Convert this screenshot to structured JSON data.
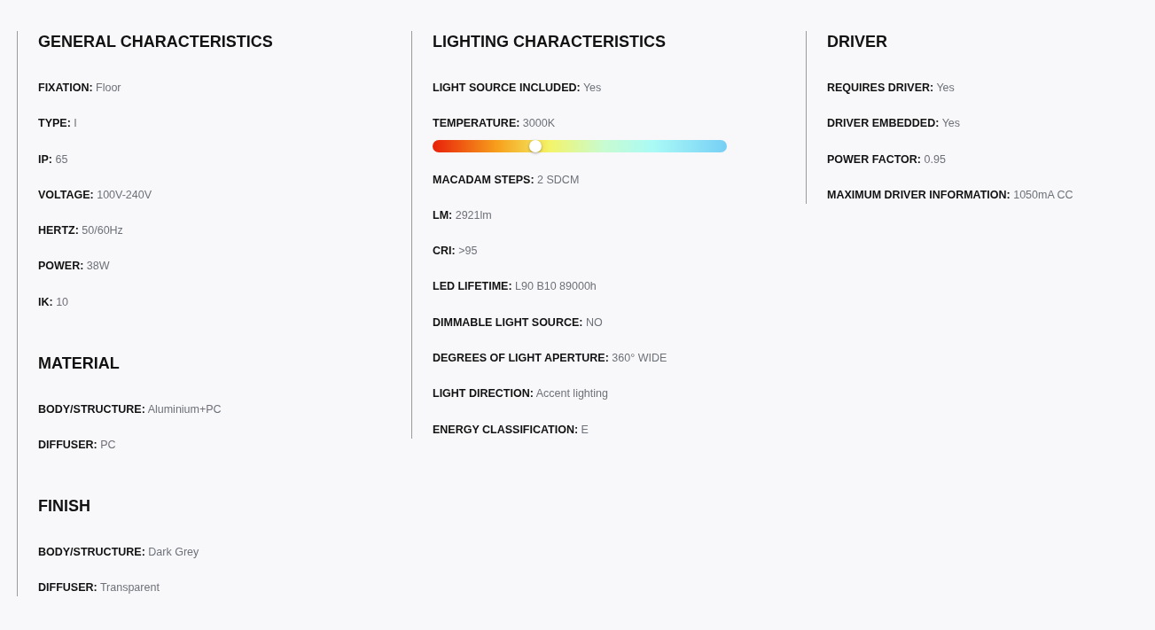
{
  "columns": [
    {
      "sections": [
        {
          "title": "GENERAL CHARACTERISTICS",
          "items": [
            {
              "label": "FIXATION:",
              "value": "Floor"
            },
            {
              "label": "TYPE:",
              "value": "I"
            },
            {
              "label": "IP:",
              "value": "65"
            },
            {
              "label": "VOLTAGE:",
              "value": "100V-240V"
            },
            {
              "label": "HERTZ:",
              "value": "50/60Hz"
            },
            {
              "label": "POWER:",
              "value": "38W"
            },
            {
              "label": "IK:",
              "value": "10"
            }
          ]
        },
        {
          "title": "MATERIAL",
          "items": [
            {
              "label": "BODY/STRUCTURE:",
              "value": "Aluminium+PC"
            },
            {
              "label": "DIFFUSER:",
              "value": "PC"
            }
          ]
        },
        {
          "title": "FINISH",
          "items": [
            {
              "label": "BODY/STRUCTURE:",
              "value": "Dark Grey"
            },
            {
              "label": "DIFFUSER:",
              "value": "Transparent"
            }
          ]
        }
      ]
    },
    {
      "sections": [
        {
          "title": "LIGHTING CHARACTERISTICS",
          "items": [
            {
              "label": "LIGHT SOURCE INCLUDED:",
              "value": "Yes"
            },
            {
              "label": "TEMPERATURE:",
              "value": "3000K",
              "scale": {
                "level": 0.35
              }
            },
            {
              "label": "MACADAM STEPS:",
              "value": "2 SDCM"
            },
            {
              "label": "LM:",
              "value": "2921lm"
            },
            {
              "label": "CRI:",
              "value": ">95"
            },
            {
              "label": "LED LIFETIME:",
              "value": "L90 B10 89000h"
            },
            {
              "label": "DIMMABLE LIGHT SOURCE:",
              "value": "NO"
            },
            {
              "label": "DEGREES OF LIGHT APERTURE:",
              "value": "360° WIDE"
            },
            {
              "label": "LIGHT DIRECTION:",
              "value": "Accent lighting"
            },
            {
              "label": "ENERGY CLASSIFICATION:",
              "value": "E"
            }
          ]
        }
      ]
    },
    {
      "sections": [
        {
          "title": "DRIVER",
          "items": [
            {
              "label": "REQUIRES DRIVER:",
              "value": "Yes"
            },
            {
              "label": "DRIVER EMBEDDED:",
              "value": "Yes"
            },
            {
              "label": "POWER FACTOR:",
              "value": "0.95"
            },
            {
              "label": "MAXIMUM DRIVER INFORMATION:",
              "value": "1050mA CC"
            }
          ]
        }
      ]
    }
  ]
}
